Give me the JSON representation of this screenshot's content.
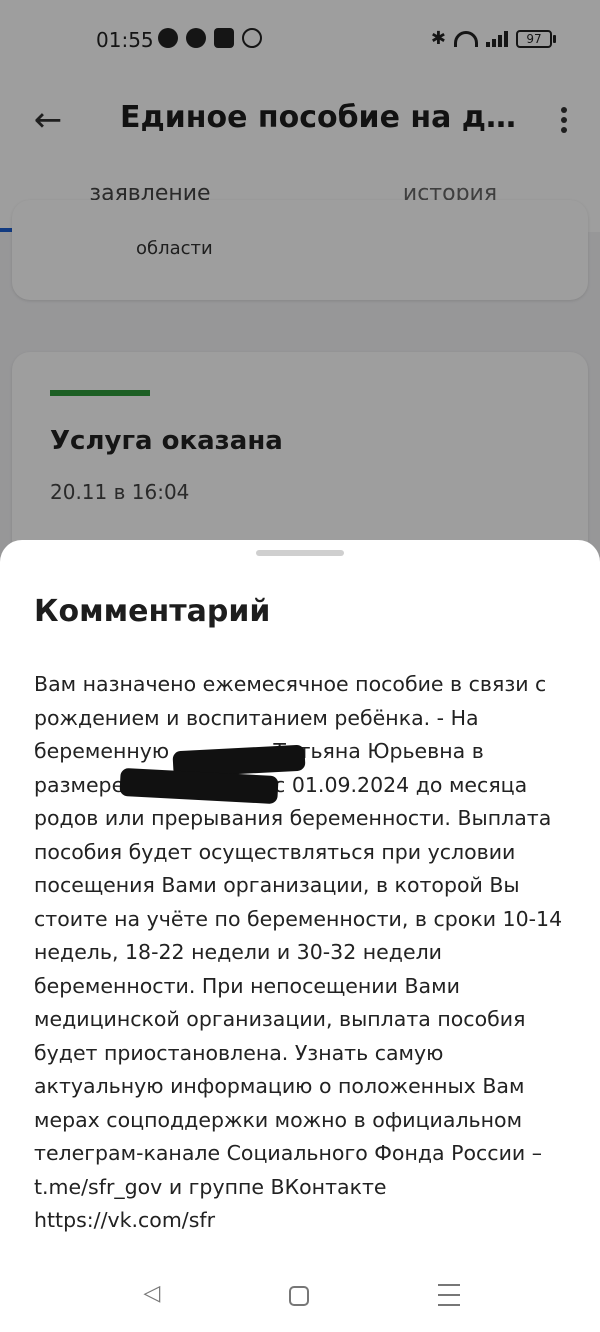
{
  "status_bar": {
    "time": "01:55",
    "battery": "97",
    "icons": [
      "face-icon",
      "face-icon",
      "app-icon",
      "viber-icon",
      "bluetooth-icon",
      "wifi-icon",
      "signal-icon",
      "battery-icon"
    ]
  },
  "app_bar": {
    "title": "Единое пособие на дет...",
    "back_icon": "arrow-back-icon",
    "menu_icon": "more-vert-icon"
  },
  "tabs": [
    {
      "label": "заявление",
      "active": true
    },
    {
      "label": "история",
      "active": false
    }
  ],
  "cards": {
    "top_partial_text": "области",
    "status": {
      "title": "Услуга оказана",
      "date": "20.11 в 16:04",
      "strip_color": "#2f9a3a"
    }
  },
  "sheet": {
    "title": "Комментарий",
    "body": "Вам назначено ежемесячное пособие в связи с рождением и воспитанием ребёнка. - На беременную                Татьяна Юрьевна в размере                       с 01.09.2024 до месяца родов или прерывания беременности. Выплата пособия будет осуществляться при условии посещения Вами организации, в которой Вы стоите на учёте по беременности, в сроки 10-14 недель, 18-22 недели и 30-32 недели беременности. При непосещении Вами медицинской организации, выплата пособия будет приостановлена. Узнать самую актуальную информацию о положенных Вам мерах соцподдержки можно в официальном телеграм-канале Социального Фонда России – t.me/sfr_gov и группе ВКонтакте https://vk.com/sfr"
  },
  "nav": {
    "back_glyph": "◁"
  },
  "colors": {
    "accent": "#1e5fd0",
    "success": "#2f9a3a"
  }
}
